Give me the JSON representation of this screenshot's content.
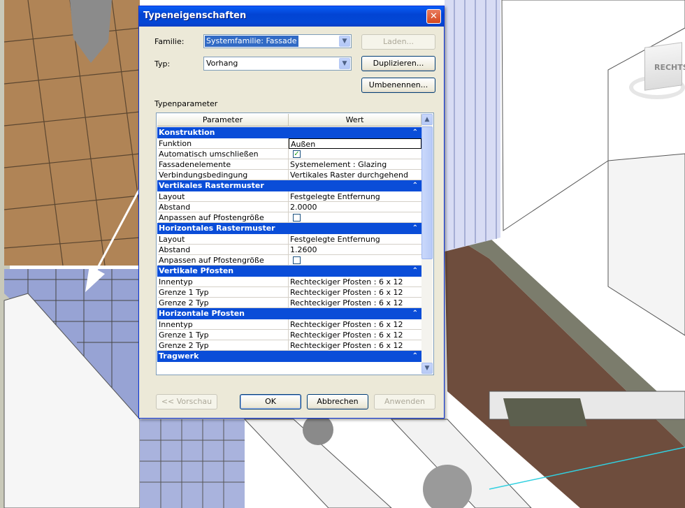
{
  "window": {
    "title": "Typeneigenschaften",
    "close_glyph": "✕"
  },
  "familie": {
    "label": "Familie:",
    "value": "Systemfamilie: Fassade"
  },
  "typ": {
    "label": "Typ:",
    "value": "Vorhang"
  },
  "buttons": {
    "laden": "Laden...",
    "duplizieren": "Duplizieren...",
    "umbenennen": "Umbenennen...",
    "vorschau": "<< Vorschau",
    "ok": "OK",
    "abbrechen": "Abbrechen",
    "anwenden": "Anwenden"
  },
  "typenparameter_label": "Typenparameter",
  "table": {
    "col_parameter": "Parameter",
    "col_wert": "Wert",
    "groups": [
      {
        "name": "Konstruktion",
        "rows": [
          {
            "param": "Funktion",
            "value": "Außen"
          },
          {
            "param": "Automatisch umschließen",
            "checkbox": true,
            "checked": true
          },
          {
            "param": "Fassadenelemente",
            "value": "Systemelement : Glazing"
          },
          {
            "param": "Verbindungsbedingung",
            "value": "Vertikales Raster durchgehend"
          }
        ]
      },
      {
        "name": "Vertikales Rastermuster",
        "rows": [
          {
            "param": "Layout",
            "value": "Festgelegte Entfernung"
          },
          {
            "param": "Abstand",
            "value": "2.0000"
          },
          {
            "param": "Anpassen auf Pfostengröße",
            "checkbox": true,
            "checked": false
          }
        ]
      },
      {
        "name": "Horizontales Rastermuster",
        "rows": [
          {
            "param": "Layout",
            "value": "Festgelegte Entfernung"
          },
          {
            "param": "Abstand",
            "value": "1.2600"
          },
          {
            "param": "Anpassen auf Pfostengröße",
            "checkbox": true,
            "checked": false
          }
        ]
      },
      {
        "name": "Vertikale Pfosten",
        "rows": [
          {
            "param": "Innentyp",
            "value": "Rechteckiger Pfosten : 6 x 12"
          },
          {
            "param": "Grenze 1 Typ",
            "value": "Rechteckiger Pfosten : 6 x 12"
          },
          {
            "param": "Grenze 2 Typ",
            "value": "Rechteckiger Pfosten : 6 x 12"
          }
        ]
      },
      {
        "name": "Horizontale Pfosten",
        "rows": [
          {
            "param": "Innentyp",
            "value": "Rechteckiger Pfosten : 6 x 12"
          },
          {
            "param": "Grenze 1 Typ",
            "value": "Rechteckiger Pfosten : 6 x 12"
          },
          {
            "param": "Grenze 2 Typ",
            "value": "Rechteckiger Pfosten : 6 x 12"
          }
        ]
      },
      {
        "name": "Tragwerk",
        "rows": []
      }
    ]
  },
  "viewcube": {
    "label": "RECHTS"
  },
  "colors": {
    "accent": "#0a4dd8",
    "floor": "#a07a4e",
    "glass": "#8fa0d0",
    "path": "#6b4a3a"
  }
}
